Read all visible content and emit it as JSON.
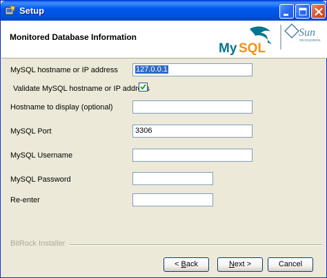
{
  "window": {
    "title": "Setup",
    "minimize_icon": "minimize-icon",
    "maximize_icon": "maximize-icon",
    "close_icon": "close-icon"
  },
  "header": {
    "title": "Monitored Database Information",
    "logo_mysql": "MySQL",
    "logo_sun": "Sun",
    "logo_sun_sub": "microsystems"
  },
  "form": {
    "hostname_label": "MySQL hostname or IP address",
    "hostname_value": "127.0.0.1",
    "validate_label": "Validate MySQL hostname or IP address",
    "validate_checked": true,
    "display_label": "Hostname to display (optional)",
    "display_value": "",
    "port_label": "MySQL Port",
    "port_value": "3306",
    "username_label": "MySQL Username",
    "username_value": "",
    "password_label": "MySQL Password",
    "password_value": "",
    "reenter_label": "Re-enter",
    "reenter_value": ""
  },
  "footer": {
    "brand": "BitRock Installer",
    "back_prefix": "< ",
    "back_key": "B",
    "back_rest": "ack",
    "next_key": "N",
    "next_rest": "ext >",
    "cancel": "Cancel"
  },
  "colors": {
    "titlebar": "#0058ee",
    "close": "#d9582e",
    "window_bg": "#ece9d8",
    "selection": "#316ac5",
    "mysql_blue": "#00758f",
    "mysql_orange": "#f29111"
  }
}
